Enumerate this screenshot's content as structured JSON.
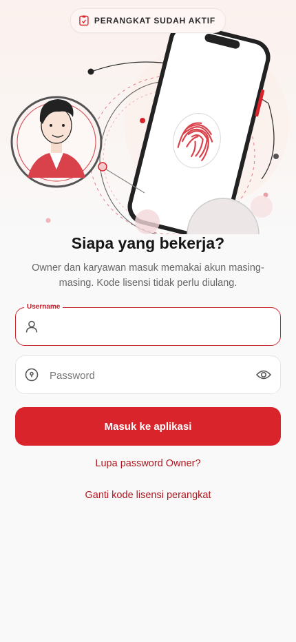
{
  "badge": {
    "icon": "phone-license-icon",
    "label": "PERANGKAT SUDAH AKTIF"
  },
  "hero": {
    "illustration": "phone-fingerprint-person-illustration"
  },
  "title": "Siapa yang bekerja?",
  "subtitle": "Owner dan karyawan masuk memakai akun masing-masing. Kode lisensi tidak perlu diulang.",
  "form": {
    "username": {
      "label": "Username",
      "value": "",
      "placeholder": "",
      "icon": "user-icon"
    },
    "password": {
      "value": "",
      "placeholder": "Password",
      "icon": "lock-icon",
      "toggle_icon": "eye-icon"
    },
    "submit_label": "Masuk ke aplikasi"
  },
  "links": {
    "forgot": "Lupa password Owner?",
    "change_license": "Ganti kode lisensi perangkat"
  },
  "colors": {
    "accent": "#d9242c",
    "link": "#b0161f",
    "background": "#f9f9f9"
  }
}
